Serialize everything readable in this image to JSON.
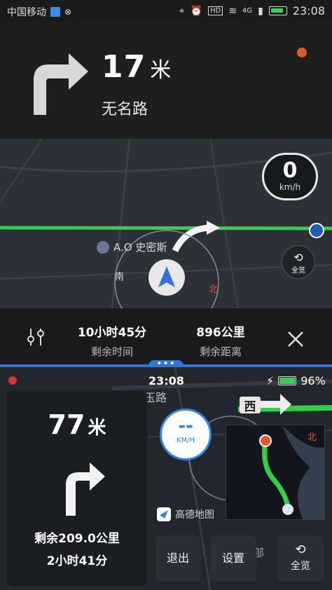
{
  "status_bar": {
    "carrier": "中国移动",
    "time": "23:08",
    "hd": "HD",
    "net": "4G"
  },
  "guidance": {
    "distance": "17",
    "unit": "米",
    "road": "无名路"
  },
  "map_top": {
    "speed_value": "0",
    "speed_unit": "km/h",
    "poi": "A.O 史密斯",
    "compass_south": "南",
    "compass_north": "北",
    "overview_label": "全览"
  },
  "trip": {
    "time_value": "10小时45分",
    "time_label": "剩余时间",
    "dist_value": "896公里",
    "dist_label": "剩余距离"
  },
  "handle_label": "•••",
  "screen2": {
    "time": "23:08",
    "battery": "96%",
    "road_label": "玉路",
    "west": "西",
    "north_badge": "北",
    "speed_dash": "--",
    "speed_unit": "KM/H",
    "brand": "高德地图",
    "distance": "77",
    "unit": "米",
    "remain_dist": "剩余209.0公里",
    "remain_time": "2小时41分",
    "btn_exit": "退出",
    "btn_settings": "设置",
    "btn_overview": "全览",
    "partial_text": "部"
  },
  "colors": {
    "route_green": "#2fd14a",
    "accent_blue": "#2a78d8",
    "panel": "#1e1e1e"
  }
}
